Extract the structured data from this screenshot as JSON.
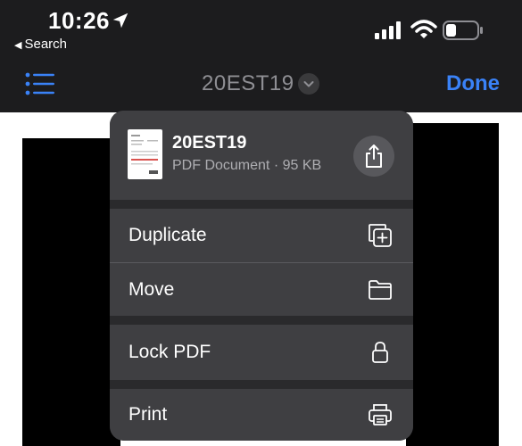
{
  "status_bar": {
    "time": "10:26",
    "back_label": "Search",
    "icons": [
      "location-arrow-icon",
      "cellular-signal-icon",
      "wifi-icon",
      "battery-icon"
    ]
  },
  "nav_bar": {
    "title": "20EST19",
    "done_label": "Done",
    "accent_color": "#3a82f7",
    "icons": [
      "list-icon",
      "chevron-down-icon"
    ]
  },
  "menu": {
    "file_name": "20EST19",
    "file_meta": "PDF Document · 95 KB",
    "items": [
      {
        "label": "Duplicate",
        "icon": "duplicate-icon"
      },
      {
        "label": "Move",
        "icon": "folder-icon"
      },
      {
        "label": "Lock PDF",
        "icon": "lock-icon"
      },
      {
        "label": "Print",
        "icon": "printer-icon"
      }
    ]
  }
}
